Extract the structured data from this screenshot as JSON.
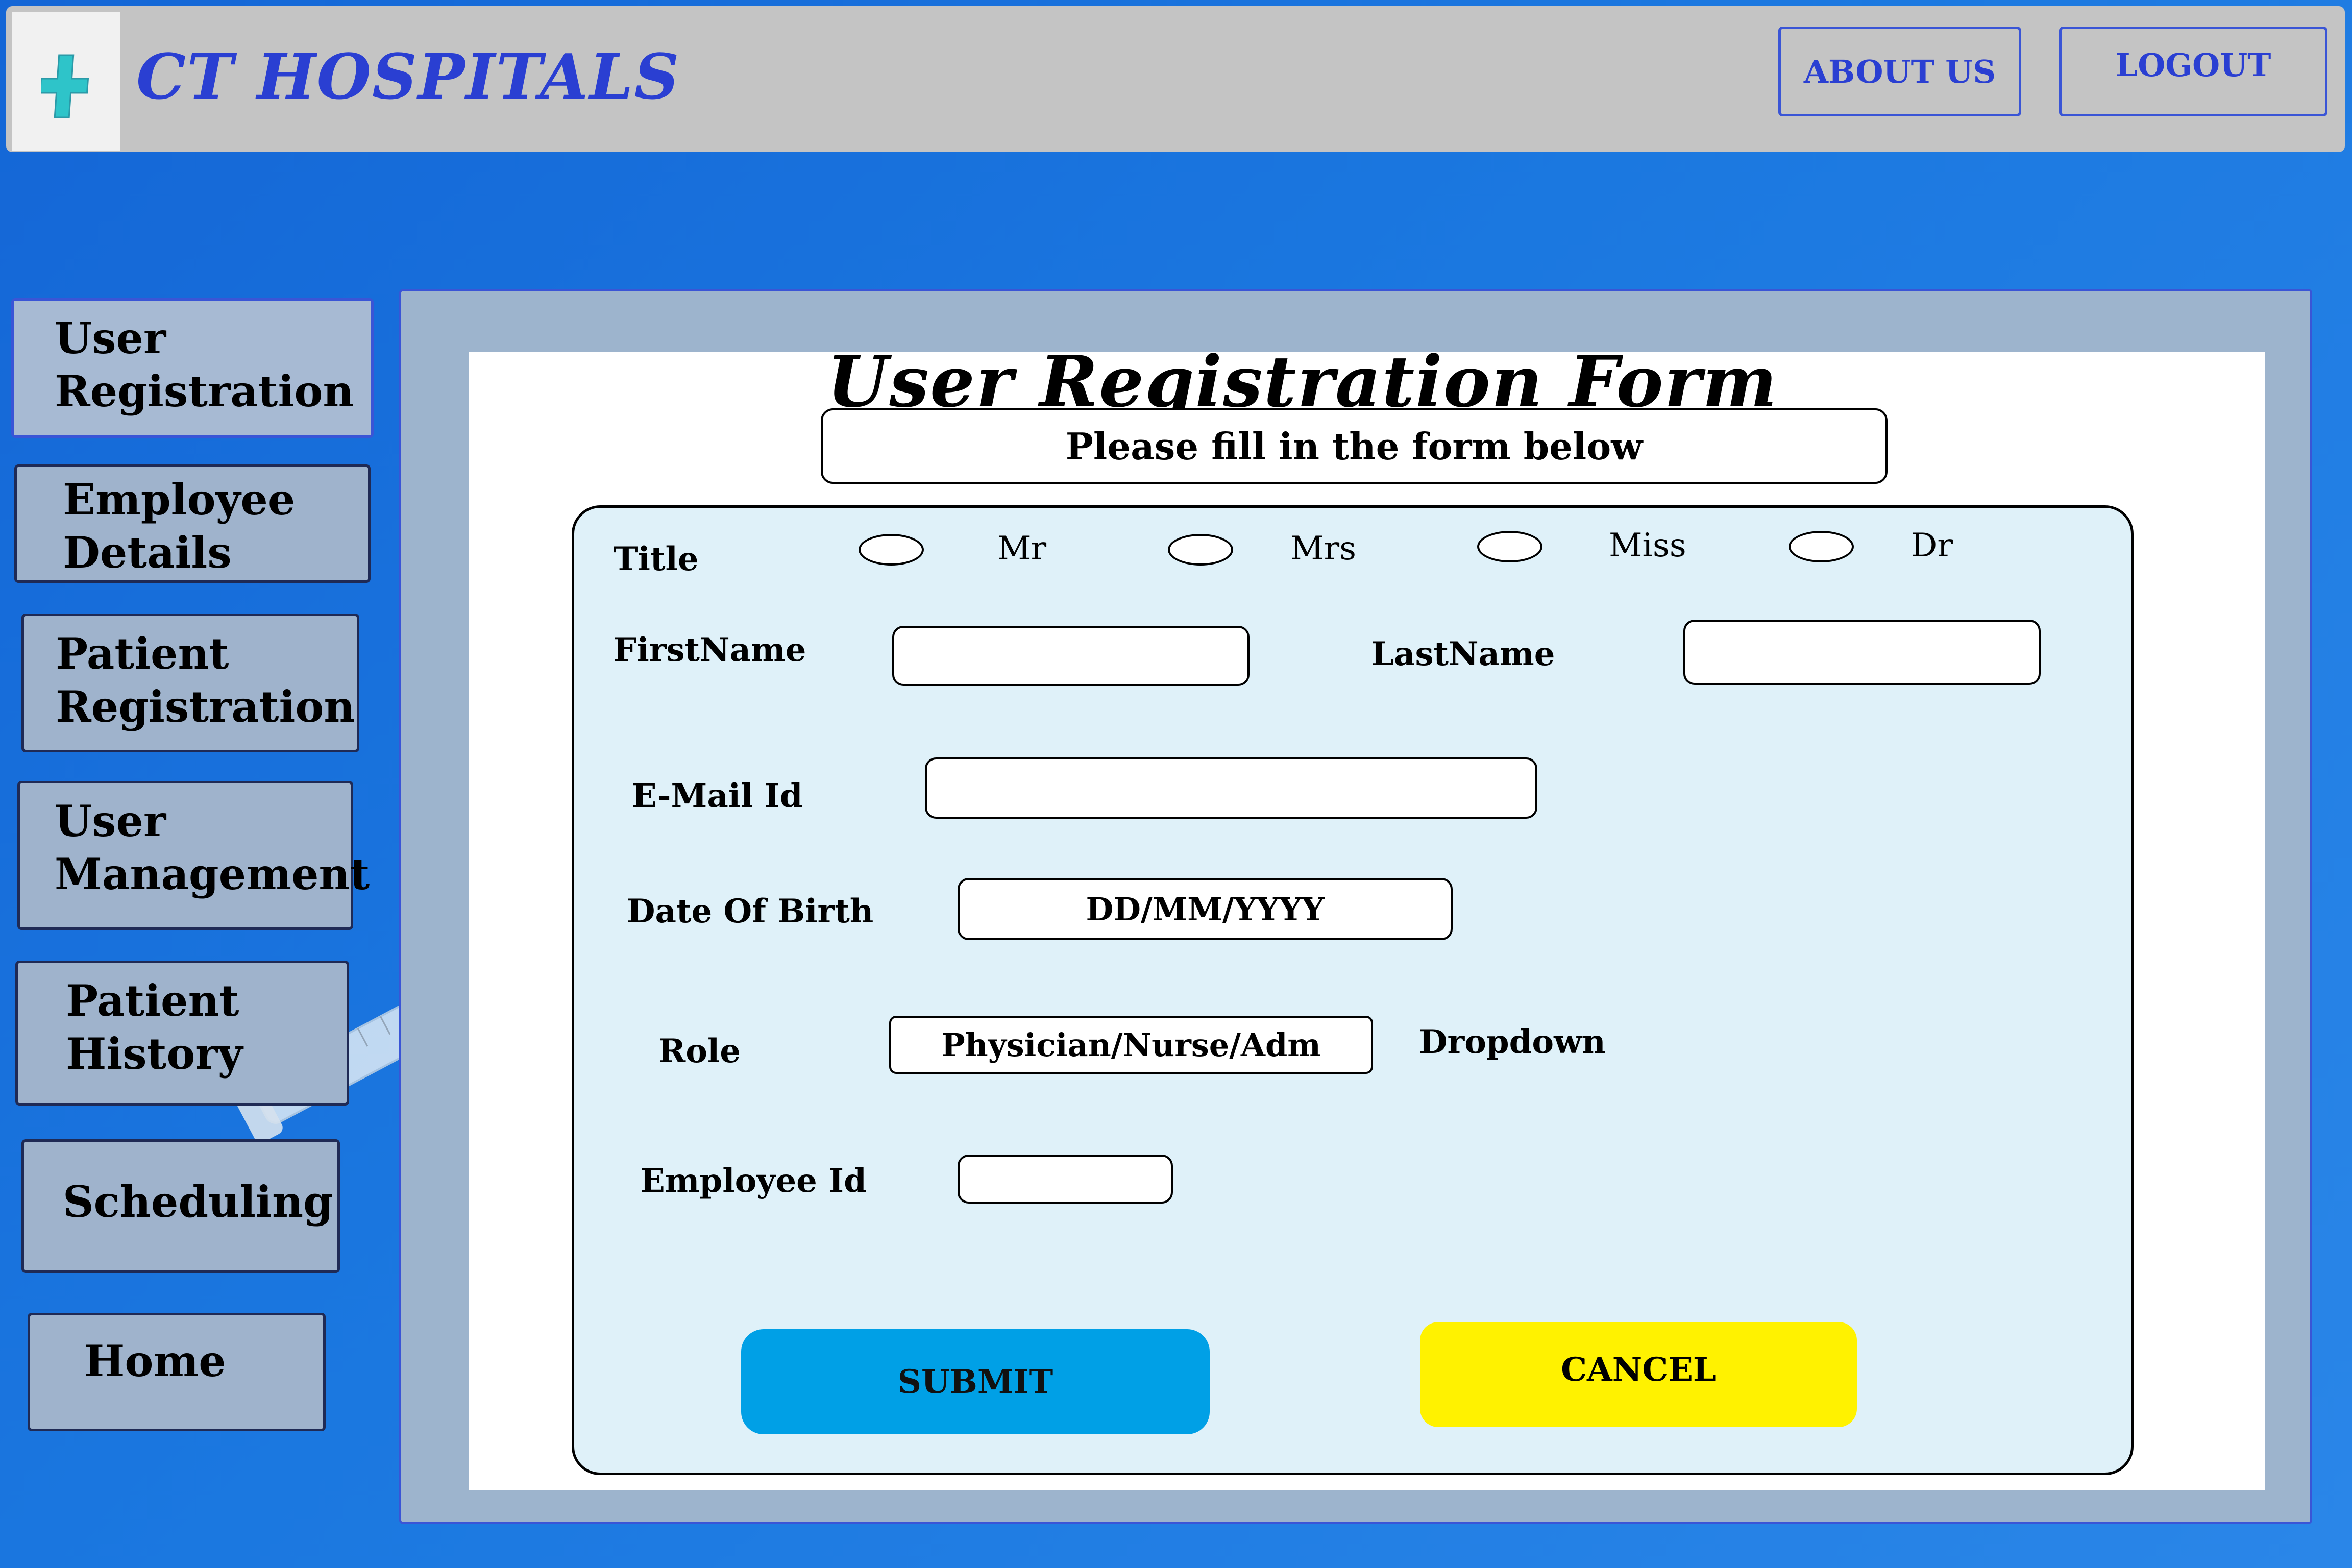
{
  "header": {
    "brand": "CT HOSPITALS",
    "about_label": "ABOUT US",
    "logout_label": "LOGOUT"
  },
  "sidebar": {
    "items": [
      {
        "line1": "User",
        "line2": "Registration"
      },
      {
        "line1": "Employee",
        "line2": "Details"
      },
      {
        "line1": "Patient",
        "line2": "Registration"
      },
      {
        "line1": "User",
        "line2": "Management"
      },
      {
        "line1": "Patient",
        "line2": "History"
      },
      {
        "line1": "Scheduling",
        "line2": ""
      },
      {
        "line1": "Home",
        "line2": ""
      }
    ]
  },
  "form": {
    "title": "User Registration Form",
    "subtitle": "Please fill in the form below",
    "title_label": "Title",
    "title_options": [
      "Mr",
      "Mrs",
      "Miss",
      "Dr"
    ],
    "firstname_label": "FirstName",
    "lastname_label": "LastName",
    "email_label": "E-Mail Id",
    "dob_label": "Date Of Birth",
    "dob_placeholder": "DD/MM/YYYY",
    "role_label": "Role",
    "role_value": "Physician/Nurse/Adm",
    "role_note": "Dropdown",
    "employee_id_label": "Employee Id",
    "submit_label": "SUBMIT",
    "cancel_label": "CANCEL"
  },
  "colors": {
    "background": "#1b78e0",
    "header": "#c4c4c4",
    "brand": "#2a3fd2",
    "sidebar_item": "#9fb3cc",
    "form_card": "#dff1f9",
    "submit": "#00a0e6",
    "cancel": "#fff200"
  },
  "icons": {
    "logo": "medical-cross-icon",
    "decoration": "syringe-icon"
  }
}
